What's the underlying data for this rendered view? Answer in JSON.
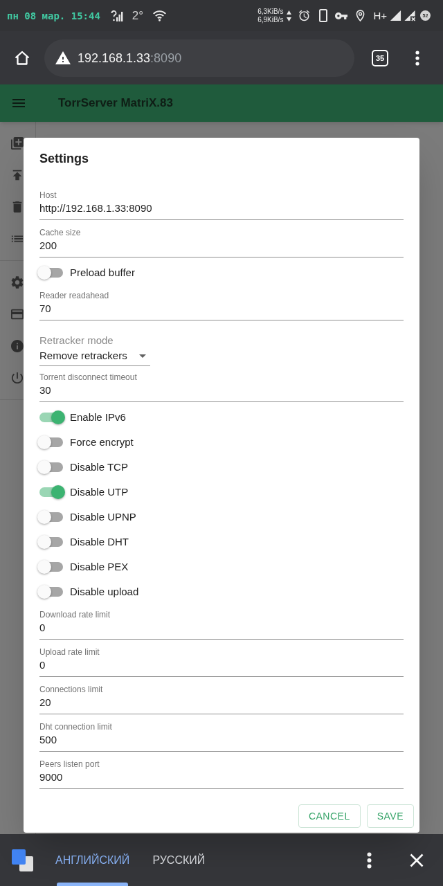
{
  "status_bar": {
    "time": "пн 08 мар. 15:44",
    "temperature": "2°",
    "network_speeds": [
      "6,3KiB/s",
      "6,9KiB/s"
    ],
    "network_type": "H+",
    "battery": "52"
  },
  "browser": {
    "url_host": "192.168.1.33",
    "url_port": ":8090",
    "tab_count": "35"
  },
  "app_bar": {
    "title": "TorrServer MatriX.83"
  },
  "settings_dialog": {
    "title": "Settings",
    "fields": [
      {
        "kind": "text",
        "label": "Host",
        "value": "http://192.168.1.33:8090"
      },
      {
        "kind": "text",
        "label": "Cache size",
        "value": "200"
      },
      {
        "kind": "switch",
        "label": "Preload buffer",
        "on": false
      },
      {
        "kind": "text",
        "label": "Reader readahead",
        "value": "70"
      },
      {
        "kind": "select",
        "label": "Retracker mode",
        "value": "Remove retrackers"
      },
      {
        "kind": "text",
        "label": "Torrent disconnect timeout",
        "value": "30"
      },
      {
        "kind": "switch",
        "label": "Enable IPv6",
        "on": true
      },
      {
        "kind": "switch",
        "label": "Force encrypt",
        "on": false
      },
      {
        "kind": "switch",
        "label": "Disable TCP",
        "on": false
      },
      {
        "kind": "switch",
        "label": "Disable UTP",
        "on": true
      },
      {
        "kind": "switch",
        "label": "Disable UPNP",
        "on": false
      },
      {
        "kind": "switch",
        "label": "Disable DHT",
        "on": false
      },
      {
        "kind": "switch",
        "label": "Disable PEX",
        "on": false
      },
      {
        "kind": "switch",
        "label": "Disable upload",
        "on": false
      },
      {
        "kind": "text",
        "label": "Download rate limit",
        "value": "0"
      },
      {
        "kind": "text",
        "label": "Upload rate limit",
        "value": "0"
      },
      {
        "kind": "text",
        "label": "Connections limit",
        "value": "20"
      },
      {
        "kind": "text",
        "label": "Dht connection limit",
        "value": "500"
      },
      {
        "kind": "text",
        "label": "Peers listen port",
        "value": "9000"
      }
    ],
    "buttons": [
      "CANCEL",
      "SAVE"
    ]
  },
  "translate_bar": {
    "languages": [
      {
        "label": "АНГЛИЙСКИЙ",
        "selected": true
      },
      {
        "label": "РУССКИЙ",
        "selected": false
      }
    ]
  }
}
